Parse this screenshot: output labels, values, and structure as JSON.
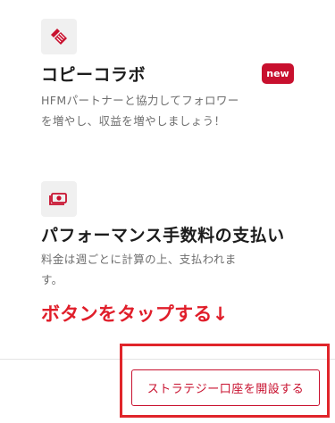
{
  "features": [
    {
      "icon": "copy-collab-icon",
      "title": "コピーコラボ",
      "badge": "new",
      "description": "HFMパートナーと協力してフォロワーを増やし、収益を増やしましょう！"
    },
    {
      "icon": "payment-money-icon",
      "title": "パフォーマンス手数料の支払い",
      "description": "料金は週ごとに計算の上、支払われます。"
    }
  ],
  "annotation": {
    "text": "ボタンをタップする↓",
    "color": "#e01e2a"
  },
  "cta": {
    "label": "ストラテジー口座を開設する"
  },
  "colors": {
    "brand_red": "#c8102e",
    "highlight_red": "#e0252a",
    "icon_bg": "#f0f0f0",
    "desc_gray": "#6e6e6e"
  }
}
